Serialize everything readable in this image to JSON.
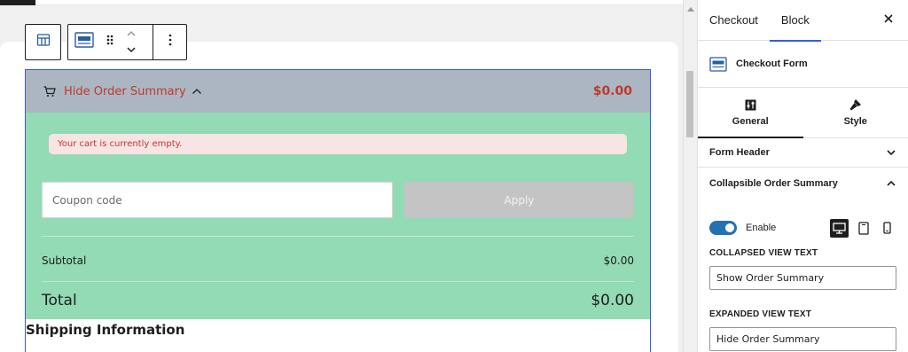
{
  "canvas": {
    "toolbar": {
      "parent_icon": "table-icon",
      "block_icon": "checkout-form-icon",
      "drag_icon": "drag-handle-icon",
      "move_icons": [
        "chevron-up-icon",
        "chevron-down-icon"
      ],
      "options_icon": "more-vertical-icon"
    },
    "summary": {
      "toggle_label": "Hide Order Summary",
      "total": "$0.00"
    },
    "notice": "Your cart is currently empty.",
    "coupon": {
      "placeholder": "Coupon code",
      "apply_label": "Apply"
    },
    "subtotal": {
      "label": "Subtotal",
      "value": "$0.00"
    },
    "total": {
      "label": "Total",
      "value": "$0.00"
    },
    "shipping_title": "Shipping Information",
    "colors": {
      "summary_bar": "#abb6c2",
      "summary_text": "#c0392b",
      "green_area": "#93dbb5",
      "selection": "#3858e9"
    }
  },
  "sidebar": {
    "tabs": [
      {
        "label": "Checkout",
        "active": false
      },
      {
        "label": "Block",
        "active": true
      }
    ],
    "block_title": "Checkout Form",
    "style_tabs": [
      {
        "label": "General",
        "icon": "general-settings-icon",
        "active": true
      },
      {
        "label": "Style",
        "icon": "brush-icon",
        "active": false
      }
    ],
    "panels": {
      "form_header": "Form Header",
      "collapsible": "Collapsible Order Summary"
    },
    "enable_label": "Enable",
    "enable_on": true,
    "devices": [
      "desktop-icon",
      "tablet-icon",
      "mobile-icon"
    ],
    "collapsed_label": "COLLAPSED VIEW TEXT",
    "collapsed_value": "Show Order Summary",
    "expanded_label": "EXPANDED VIEW TEXT",
    "expanded_value": "Hide Order Summary"
  }
}
